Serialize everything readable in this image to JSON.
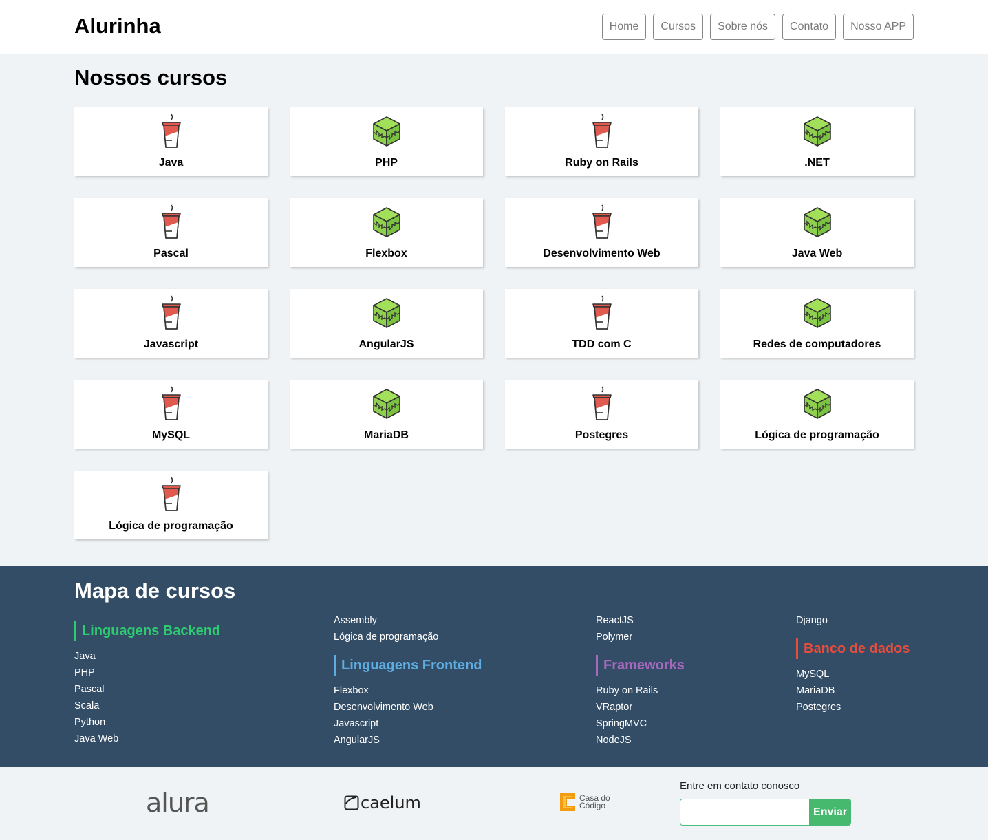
{
  "header": {
    "logo": "Alurinha",
    "nav": [
      "Home",
      "Cursos",
      "Sobre nós",
      "Contato",
      "Nosso APP"
    ]
  },
  "courses": {
    "title": "Nossos cursos",
    "items": [
      {
        "label": "Java",
        "icon": "cup-icon"
      },
      {
        "label": "PHP",
        "icon": "cube-icon"
      },
      {
        "label": "Ruby on Rails",
        "icon": "cup-icon"
      },
      {
        "label": ".NET",
        "icon": "cube-icon"
      },
      {
        "label": "Pascal",
        "icon": "cup-icon"
      },
      {
        "label": "Flexbox",
        "icon": "cube-icon"
      },
      {
        "label": "Desenvolvimento Web",
        "icon": "cup-icon"
      },
      {
        "label": "Java Web",
        "icon": "cube-icon"
      },
      {
        "label": "Javascript",
        "icon": "cup-icon"
      },
      {
        "label": "AngularJS",
        "icon": "cube-icon"
      },
      {
        "label": "TDD com C",
        "icon": "cup-icon"
      },
      {
        "label": "Redes de computadores",
        "icon": "cube-icon"
      },
      {
        "label": "MySQL",
        "icon": "cup-icon"
      },
      {
        "label": "MariaDB",
        "icon": "cube-icon"
      },
      {
        "label": "Postegres",
        "icon": "cup-icon"
      },
      {
        "label": "Lógica de programação",
        "icon": "cube-icon"
      },
      {
        "label": "Lógica de programação",
        "icon": "cup-icon"
      }
    ]
  },
  "map": {
    "title": "Mapa de cursos",
    "backend": {
      "label": "Linguagens Backend",
      "color": "#2ecc71",
      "items": [
        "Java",
        "PHP",
        "Pascal",
        "Scala",
        "Python",
        "Java Web"
      ]
    },
    "col2_top": [
      "Assembly",
      "Lógica de programação"
    ],
    "frontend": {
      "label": "Linguagens Frontend",
      "color": "#5dade2",
      "items": [
        "Flexbox",
        "Desenvolvimento Web",
        "Javascript",
        "AngularJS"
      ]
    },
    "col3_top": [
      "ReactJS",
      "Polymer"
    ],
    "frameworks": {
      "label": "Frameworks",
      "color": "#a569bd",
      "items": [
        "Ruby on Rails",
        "VRaptor",
        "SpringMVC",
        "NodeJS"
      ]
    },
    "col4_top": [
      "Django"
    ],
    "database": {
      "label": "Banco de dados",
      "color": "#e74c3c",
      "items": [
        "MySQL",
        "MariaDB",
        "Postegres"
      ]
    }
  },
  "footer": {
    "brands": [
      "alura",
      "caelum",
      "Casa do",
      "Código"
    ],
    "contact_label": "Entre em contato conosco",
    "contact_placeholder": "",
    "send_label": "Enviar"
  }
}
